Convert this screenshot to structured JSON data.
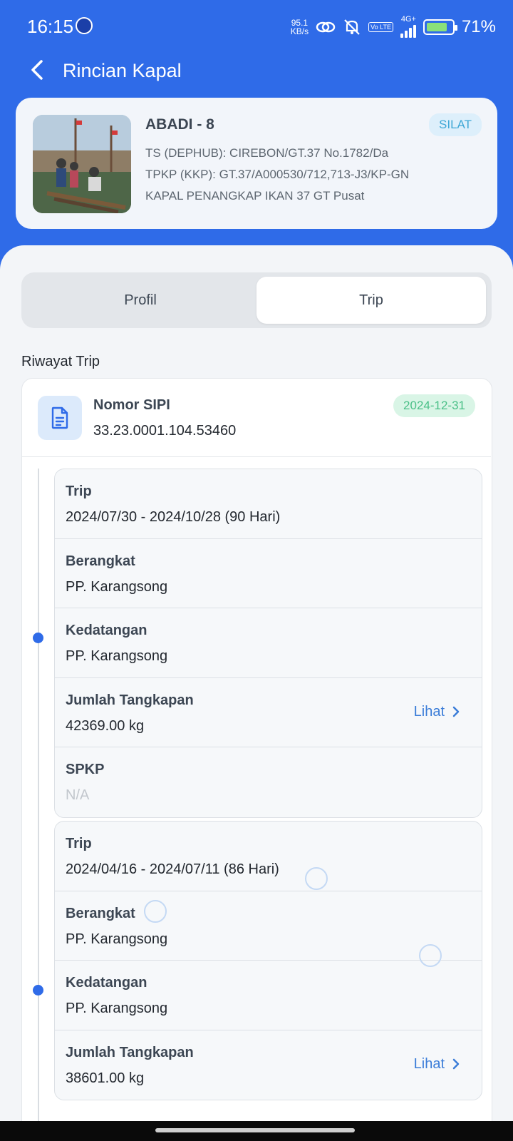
{
  "status_bar": {
    "time": "16:15",
    "net_speed_value": "95.1",
    "net_speed_unit": "KB/s",
    "network": "4G+",
    "volte": "Vo LTE",
    "battery": "71%"
  },
  "header": {
    "title": "Rincian Kapal"
  },
  "vessel": {
    "name": "ABADI - 8",
    "badge": "SILAT",
    "line1": "TS (DEPHUB): CIREBON/GT.37 No.1782/Da",
    "line2": "TPKP (KKP): GT.37/A000530/712,713-J3/KP-GN",
    "line3": "KAPAL PENANGKAP IKAN  37 GT  Pusat"
  },
  "tabs": [
    {
      "label": "Profil"
    },
    {
      "label": "Trip"
    }
  ],
  "section_title": "Riwayat Trip",
  "sipi": {
    "label": "Nomor SIPI",
    "number": "33.23.0001.104.53460",
    "date": "2024-12-31"
  },
  "trips": [
    {
      "trip_label": "Trip",
      "trip_value": "2024/07/30 - 2024/10/28 (90 Hari)",
      "berangkat_label": "Berangkat",
      "berangkat_value": "PP. Karangsong",
      "kedatangan_label": "Kedatangan",
      "kedatangan_value": "PP. Karangsong",
      "tangkapan_label": "Jumlah Tangkapan",
      "tangkapan_value": "42369.00 kg",
      "lihat": "Lihat",
      "spkp_label": "SPKP",
      "spkp_value": "N/A"
    },
    {
      "trip_label": "Trip",
      "trip_value": "2024/04/16 - 2024/07/11 (86 Hari)",
      "berangkat_label": "Berangkat",
      "berangkat_value": "PP. Karangsong",
      "kedatangan_label": "Kedatangan",
      "kedatangan_value": "PP. Karangsong",
      "tangkapan_label": "Jumlah Tangkapan",
      "tangkapan_value": "38601.00 kg",
      "lihat": "Lihat"
    }
  ]
}
